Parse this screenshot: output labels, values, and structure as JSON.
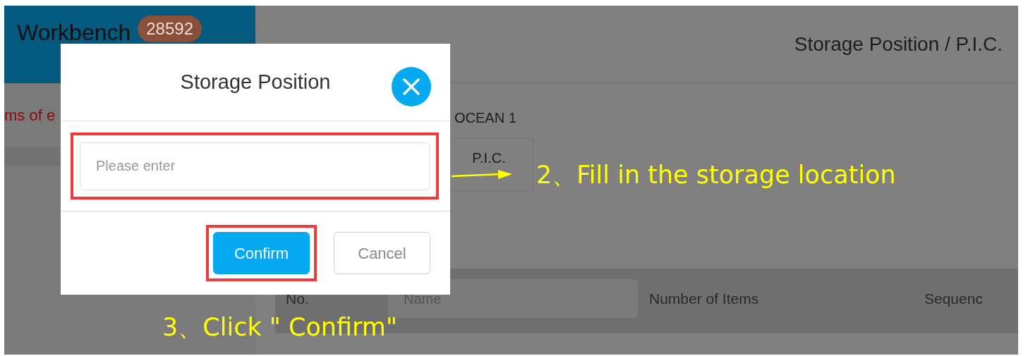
{
  "sidebar": {
    "title": "Workbench",
    "badge": "28592",
    "notice": "ms of e"
  },
  "header": {
    "title": "Storage Position / P.I.C."
  },
  "form": {
    "vessel": "OCEAN 1",
    "pic_button": "P.I.C."
  },
  "table": {
    "columns": [
      {
        "kind": "text",
        "label": "No."
      },
      {
        "kind": "field",
        "placeholder": "Name"
      },
      {
        "kind": "text",
        "label": "Number of Items"
      },
      {
        "kind": "text",
        "label": "Sequenc"
      }
    ]
  },
  "dialog": {
    "title": "Storage Position",
    "input": {
      "placeholder": "Please enter",
      "highlighted": true
    },
    "buttons": [
      {
        "label": "Confirm",
        "kind": "primary",
        "highlighted": true
      },
      {
        "label": "Cancel",
        "kind": "default",
        "highlighted": false
      }
    ]
  },
  "annotations": [
    {
      "text": "2、Fill in the storage location",
      "kind": "arrow"
    },
    {
      "text": "3、Click \" Confirm\"",
      "kind": "plain"
    }
  ]
}
